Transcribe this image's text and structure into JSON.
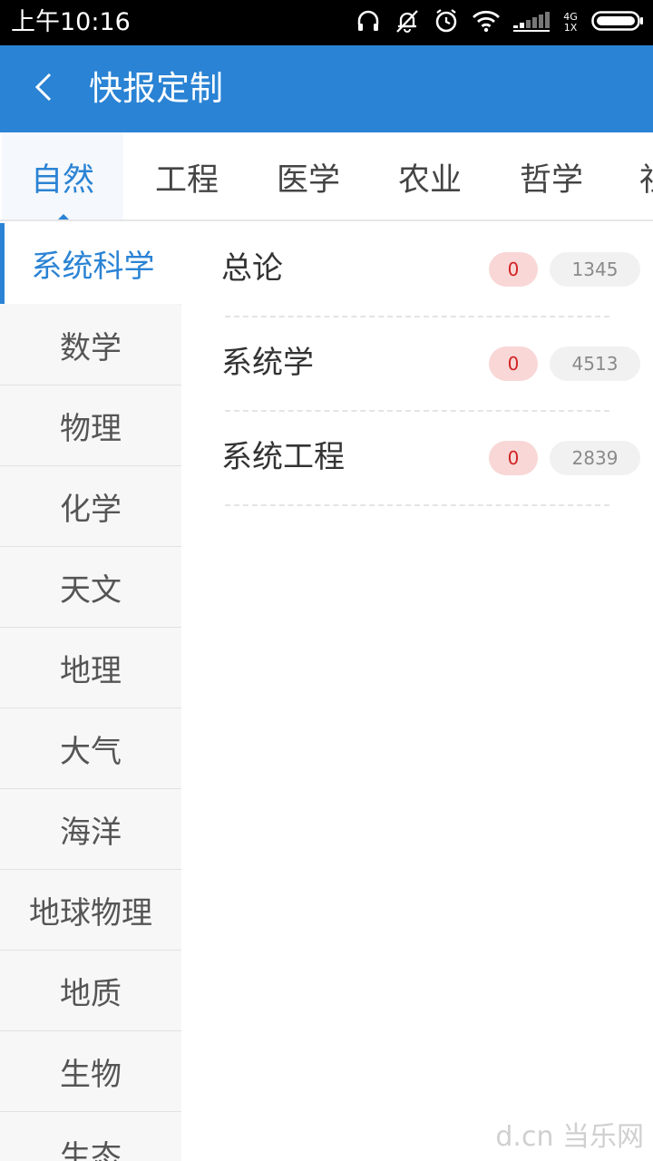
{
  "status_bar": {
    "time": "上午10:16",
    "network_top": "4G",
    "network_bottom": "1X",
    "icons": [
      "headphones-icon",
      "mute-bell-icon",
      "alarm-icon",
      "wifi-icon",
      "signal-icon",
      "battery-icon"
    ]
  },
  "app_bar": {
    "back_icon": "chevron-left-icon",
    "title": "快报定制"
  },
  "tabs": [
    {
      "label": "自然",
      "active": true
    },
    {
      "label": "工程",
      "active": false
    },
    {
      "label": "医学",
      "active": false
    },
    {
      "label": "农业",
      "active": false
    },
    {
      "label": "哲学",
      "active": false
    },
    {
      "label": "社",
      "active": false
    }
  ],
  "side_nav": [
    {
      "label": "系统科学",
      "active": true
    },
    {
      "label": "数学"
    },
    {
      "label": "物理"
    },
    {
      "label": "化学"
    },
    {
      "label": "天文"
    },
    {
      "label": "地理"
    },
    {
      "label": "大气"
    },
    {
      "label": "海洋"
    },
    {
      "label": "地球物理"
    },
    {
      "label": "地质"
    },
    {
      "label": "生物"
    },
    {
      "label": "生态"
    }
  ],
  "content": {
    "rows": [
      {
        "title": "总论",
        "new_count": "0",
        "total_count": "1345"
      },
      {
        "title": "系统学",
        "new_count": "0",
        "total_count": "4513"
      },
      {
        "title": "系统工程",
        "new_count": "0",
        "total_count": "2839"
      }
    ]
  },
  "watermark": "d.cn 当乐网",
  "colors": {
    "primary": "#2a83d4",
    "badge_red_bg": "#f9d7d7",
    "badge_red_text": "#d12424",
    "badge_gray_bg": "#f1f1f1"
  }
}
